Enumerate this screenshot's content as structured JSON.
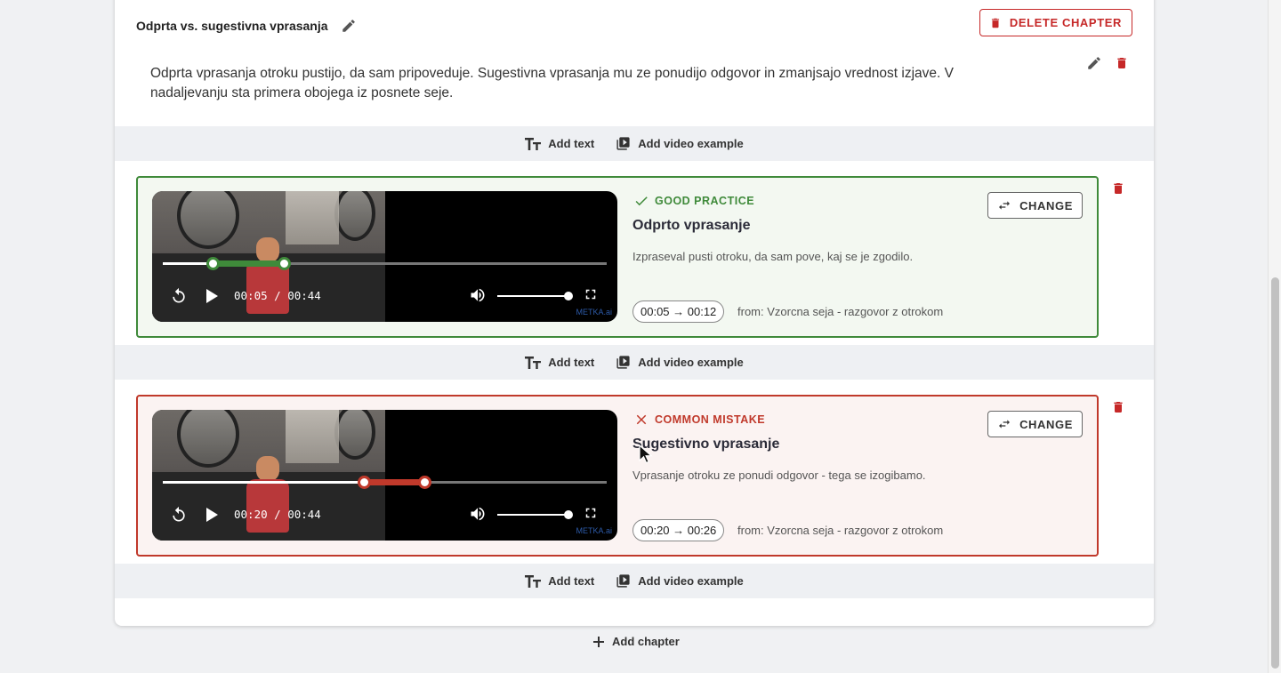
{
  "chapter": {
    "title": "Odprta vs. sugestivna vprasanja",
    "delete_label": "DELETE CHAPTER",
    "text": "Odprta vprasanja otroku pustijo, da sam pripoveduje. Sugestivna vprasanja mu ze ponudijo odgovor in zmanjsajo vrednost izjave. V nadaljevanju sta primera obojega iz posnete seje."
  },
  "add_bar": {
    "add_text_label": "Add text",
    "add_video_label": "Add video example"
  },
  "examples": [
    {
      "kind": "good",
      "badge": "GOOD PRACTICE",
      "badge_color": "#3f8a3a",
      "title": "Odprto vprasanje",
      "description": "Izpraseval pusti otroku, da sam pove, kaj se je zgodilo.",
      "range": "00:05 → 00:12",
      "from": "from: Vzorcna seja - razgovor z otrokom",
      "change_label": "CHANGE",
      "video": {
        "time": "00:05 / 00:44",
        "current_s": 5,
        "duration_s": 44,
        "clip_start_s": 5,
        "clip_end_s": 12,
        "volume": 1,
        "watermark": "METKA.ai"
      }
    },
    {
      "kind": "bad",
      "badge": "COMMON MISTAKE",
      "badge_color": "#c0392b",
      "title": "Sugestivno vprasanje",
      "description": "Vprasanje otroku ze ponudi odgovor - tega se izogibamo.",
      "range": "00:20 → 00:26",
      "from": "from: Vzorcna seja - razgovor z otrokom",
      "change_label": "CHANGE",
      "video": {
        "time": "00:20 / 00:44",
        "current_s": 20,
        "duration_s": 44,
        "clip_start_s": 20,
        "clip_end_s": 26,
        "volume": 1,
        "watermark": "METKA.ai"
      }
    }
  ],
  "footer": {
    "add_chapter_label": "Add chapter"
  }
}
